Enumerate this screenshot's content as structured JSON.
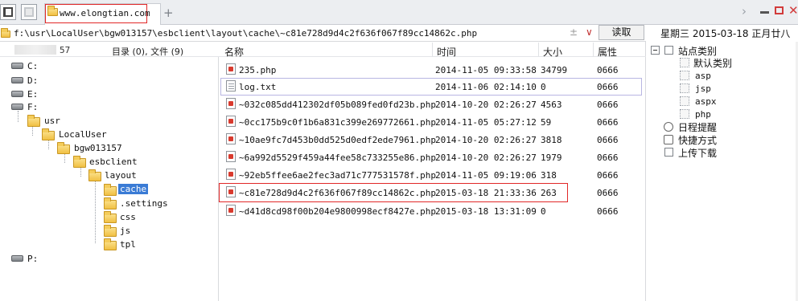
{
  "tab": {
    "title": "www.elongtian.com",
    "new_tab_label": "+"
  },
  "window": {
    "chevron": "›",
    "close": "✕"
  },
  "address": {
    "path": "f:\\usr\\LocalUser\\bgw013157\\esbclient\\layout\\cache\\~c81e728d9d4c2f636f067f89cc14862c.php",
    "plus_minus": "±",
    "dropdown": "∨",
    "read_button": "读取"
  },
  "date_header": "星期三  2015-03-18  正月廿八",
  "tree": {
    "count_num": "57",
    "count_label": "目录 (0), 文件 (9)",
    "drives": [
      "C:",
      "D:",
      "E:",
      "F:",
      "P:"
    ],
    "folders": {
      "usr": "usr",
      "localuser": "LocalUser",
      "bgw": "bgw013157",
      "esbclient": "esbclient",
      "layout": "layout",
      "cache": "cache",
      "settings": ".settings",
      "css": "css",
      "js": "js",
      "tpl": "tpl"
    }
  },
  "list": {
    "columns": {
      "name": "名称",
      "time": "时间",
      "size": "大小",
      "attr": "属性"
    },
    "files": [
      {
        "name": "235.php",
        "time": "2014-11-05 09:33:58",
        "size": "34799",
        "attr": "0666",
        "type": "php"
      },
      {
        "name": "log.txt",
        "time": "2014-11-06 02:14:10",
        "size": "0",
        "attr": "0666",
        "type": "txt"
      },
      {
        "name": "~032c085dd412302df05b089fed0fd23b.php",
        "time": "2014-10-20 02:26:27",
        "size": "4563",
        "attr": "0666",
        "type": "php"
      },
      {
        "name": "~0cc175b9c0f1b6a831c399e269772661.php",
        "time": "2014-11-05 05:27:12",
        "size": "59",
        "attr": "0666",
        "type": "php"
      },
      {
        "name": "~10ae9fc7d453b0dd525d0edf2ede7961.php",
        "time": "2014-10-20 02:26:27",
        "size": "3818",
        "attr": "0666",
        "type": "php"
      },
      {
        "name": "~6a992d5529f459a44fee58c733255e86.php",
        "time": "2014-10-20 02:26:27",
        "size": "1979",
        "attr": "0666",
        "type": "php"
      },
      {
        "name": "~92eb5ffee6ae2fec3ad71c777531578f.php",
        "time": "2014-11-05 09:19:06",
        "size": "318",
        "attr": "0666",
        "type": "php"
      },
      {
        "name": "~c81e728d9d4c2f636f067f89cc14862c.php",
        "time": "2015-03-18 21:33:36",
        "size": "263",
        "attr": "0666",
        "type": "php"
      },
      {
        "name": "~d41d8cd98f00b204e9800998ecf8427e.php",
        "time": "2015-03-18 13:31:09",
        "size": "0",
        "attr": "0666",
        "type": "php"
      }
    ]
  },
  "sites": {
    "root": "站点类别",
    "default": "默认类别",
    "categories": [
      "asp",
      "jsp",
      "aspx",
      "php"
    ],
    "schedule": "日程提醒",
    "shortcuts": "快捷方式",
    "upload": "上传下载"
  }
}
